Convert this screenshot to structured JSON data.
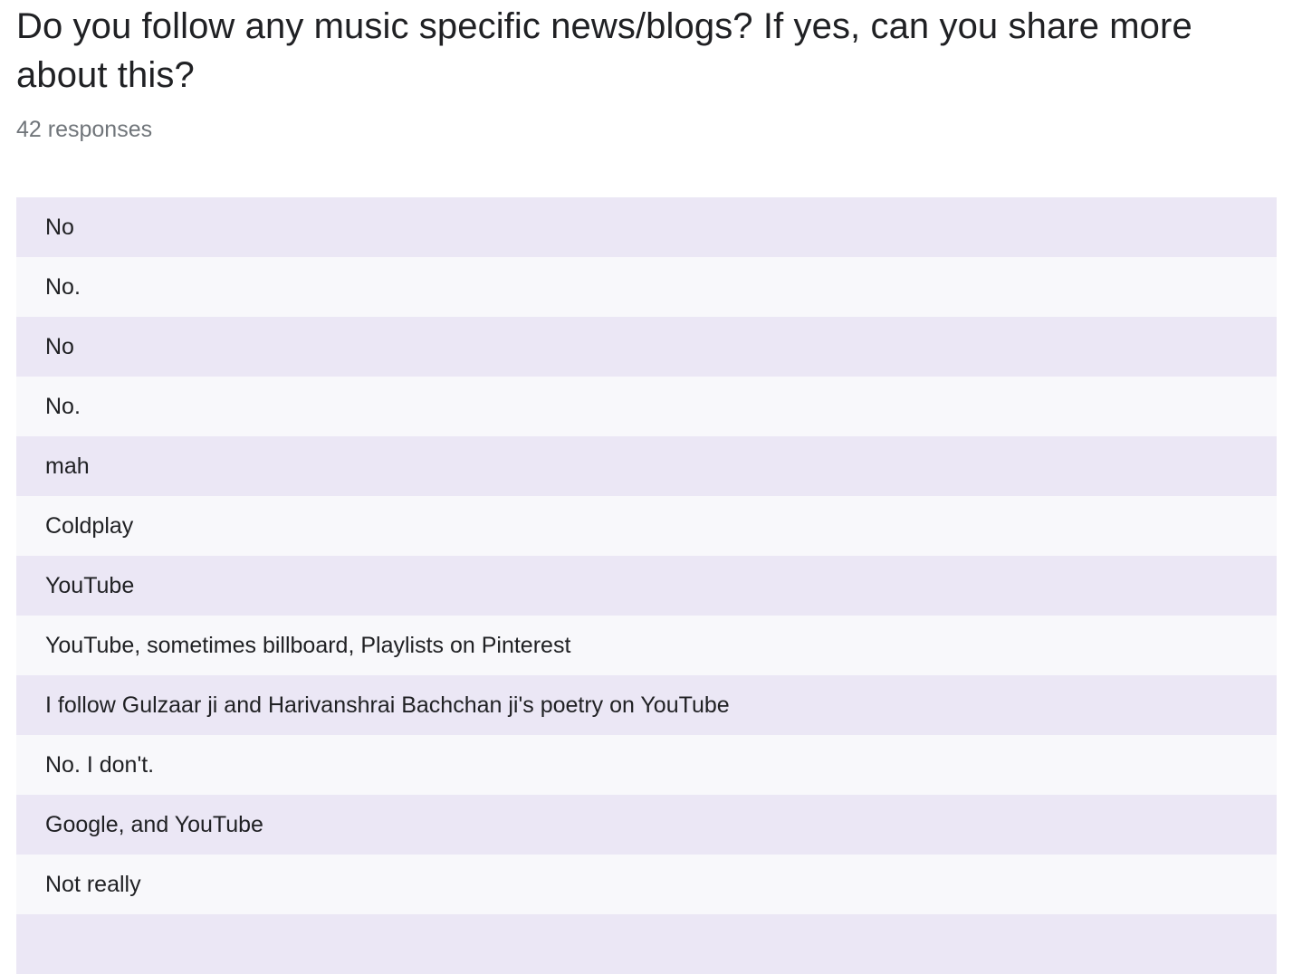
{
  "question": {
    "title": "Do you follow any music specific news/blogs? If yes, can you share more about this?",
    "response_count": "42 responses"
  },
  "responses": [
    "No",
    "No.",
    "No",
    "No.",
    "mah",
    "Coldplay",
    "YouTube",
    "YouTube, sometimes billboard, Playlists on Pinterest",
    "I follow Gulzaar ji and Harivanshrai Bachchan ji's poetry on YouTube",
    "No. I don't.",
    "Google, and YouTube",
    "Not really",
    ""
  ],
  "colors": {
    "row_odd": "#ebe7f5",
    "row_even": "#f8f8fb",
    "title_text": "#202124",
    "count_text": "#70757a"
  }
}
